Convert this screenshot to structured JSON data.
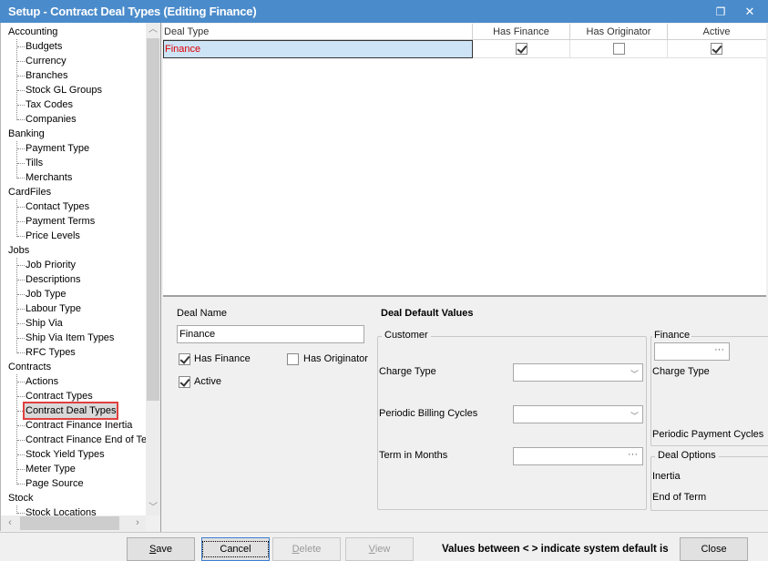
{
  "window": {
    "title": "Setup - Contract Deal Types (Editing Finance)",
    "restore_icon": "❐",
    "close_icon": "✕"
  },
  "tree": {
    "groups": [
      {
        "label": "Accounting",
        "children": [
          "Budgets",
          "Currency",
          "Branches",
          "Stock GL Groups",
          "Tax Codes",
          "Companies"
        ]
      },
      {
        "label": "Banking",
        "children": [
          "Payment Type",
          "Tills",
          "Merchants"
        ]
      },
      {
        "label": "CardFiles",
        "children": [
          "Contact Types",
          "Payment Terms",
          "Price Levels"
        ]
      },
      {
        "label": "Jobs",
        "children": [
          "Job Priority",
          "Descriptions",
          "Job Type",
          "Labour Type",
          "Ship Via",
          "Ship Via Item Types",
          "RFC Types"
        ]
      },
      {
        "label": "Contracts",
        "children": [
          "Actions",
          "Contract Types",
          "Contract Deal Types",
          "Contract Finance Inertia",
          "Contract Finance End of Te",
          "Stock Yield Types",
          "Meter Type",
          "Page Source"
        ]
      },
      {
        "label": "Stock",
        "children": [
          "Stock Locations"
        ]
      }
    ],
    "selected": "Contract Deal Types"
  },
  "grid": {
    "columns": [
      "Deal Type",
      "Has Finance",
      "Has Originator",
      "Active"
    ],
    "rows": [
      {
        "deal_type": "Finance",
        "has_finance": true,
        "has_originator": false,
        "active": true
      }
    ]
  },
  "detail": {
    "deal_name_label": "Deal Name",
    "deal_name_value": "Finance",
    "has_finance_label": "Has Finance",
    "has_finance_checked": true,
    "has_originator_label": "Has Originator",
    "has_originator_checked": false,
    "active_label": "Active",
    "active_checked": true,
    "defaults_title": "Deal Default Values",
    "customer": {
      "caption": "Customer",
      "charge_type_label": "Charge Type",
      "charge_type_value": "",
      "billing_cycles_label": "Periodic Billing Cycles",
      "billing_cycles_value": "",
      "term_label": "Term in Months",
      "term_value": ""
    },
    "finance": {
      "caption": "Finance",
      "value": "",
      "charge_type_label": "Charge Type",
      "payment_cycles_label": "Periodic Payment Cycles"
    },
    "deal_options": {
      "caption": "Deal Options",
      "inertia_label": "Inertia",
      "end_of_term_label": "End of Term"
    }
  },
  "buttons": {
    "save": "ave",
    "save_accel": "S",
    "cancel": "Cancel",
    "delete": "elete",
    "delete_accel": "D",
    "view": "iew",
    "view_accel": "V",
    "close": "Close"
  },
  "status_text": "Values between < > indicate system default is"
}
